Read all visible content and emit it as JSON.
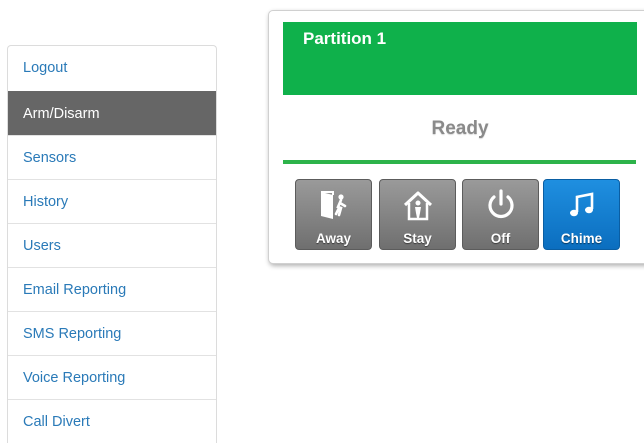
{
  "sidebar": {
    "items": [
      {
        "label": "Logout"
      },
      {
        "label": "Arm/Disarm"
      },
      {
        "label": "Sensors"
      },
      {
        "label": "History"
      },
      {
        "label": "Users"
      },
      {
        "label": "Email Reporting"
      },
      {
        "label": "SMS Reporting"
      },
      {
        "label": "Voice Reporting"
      },
      {
        "label": "Call Divert"
      }
    ],
    "active_item": "Arm/Disarm"
  },
  "partition": {
    "title": "Partition 1",
    "status": "Ready",
    "status_color": "#0fb14b",
    "buttons": [
      {
        "label": "Away",
        "icon": "door-exit-icon"
      },
      {
        "label": "Stay",
        "icon": "house-person-icon"
      },
      {
        "label": "Off",
        "icon": "power-icon"
      },
      {
        "label": "Chime",
        "icon": "music-note-icon",
        "active": true
      }
    ]
  },
  "colors": {
    "link": "#2a7ab8",
    "active_item_bg": "#666666",
    "button_gray": "#7f7f7f",
    "button_blue": "#1177cc"
  }
}
